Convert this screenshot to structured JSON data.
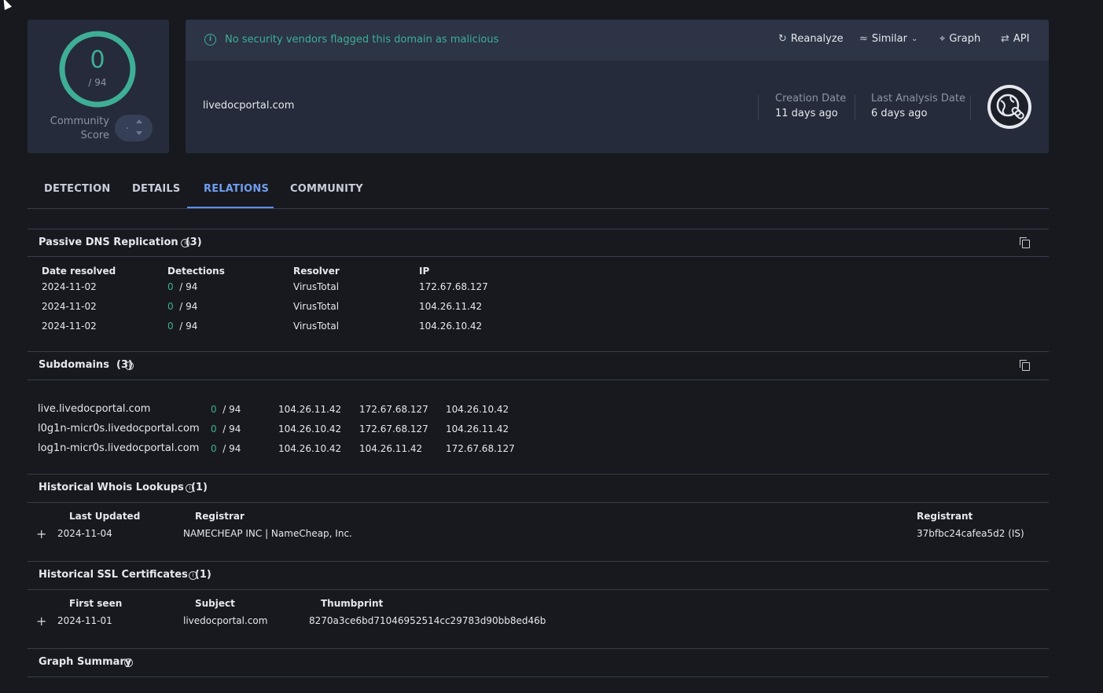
{
  "score": {
    "value": "0",
    "total": "/ 94",
    "community_line1": "Community",
    "community_line2": "Score"
  },
  "banner": {
    "text": "No security vendors flagged this domain as malicious"
  },
  "actions": {
    "reanalyze": "Reanalyze",
    "similar": "Similar",
    "graph": "Graph",
    "api": "API"
  },
  "domain": "livedocportal.com",
  "creation": {
    "label": "Creation Date",
    "value": "11 days ago"
  },
  "last_analysis": {
    "label": "Last Analysis Date",
    "value": "6 days ago"
  },
  "tabs": [
    "DETECTION",
    "DETAILS",
    "RELATIONS",
    "COMMUNITY"
  ],
  "passive_dns": {
    "title": "Passive DNS Replication",
    "count": "(3)",
    "headers": [
      "Date resolved",
      "Detections",
      "Resolver",
      "IP"
    ],
    "rows": [
      {
        "date": "2024-11-02",
        "det": "0",
        "total": "/ 94",
        "resolver": "VirusTotal",
        "ip": "172.67.68.127"
      },
      {
        "date": "2024-11-02",
        "det": "0",
        "total": "/ 94",
        "resolver": "VirusTotal",
        "ip": "104.26.11.42"
      },
      {
        "date": "2024-11-02",
        "det": "0",
        "total": "/ 94",
        "resolver": "VirusTotal",
        "ip": "104.26.10.42"
      }
    ]
  },
  "subdomains": {
    "title": "Subdomains",
    "count": "(3)",
    "rows": [
      {
        "name": "live.livedocportal.com",
        "det": "0",
        "total": "/ 94",
        "ip1": "104.26.11.42",
        "ip2": "172.67.68.127",
        "ip3": "104.26.10.42"
      },
      {
        "name": "l0g1n-micr0s.livedocportal.com",
        "det": "0",
        "total": "/ 94",
        "ip1": "104.26.10.42",
        "ip2": "172.67.68.127",
        "ip3": "104.26.11.42"
      },
      {
        "name": "log1n-micr0s.livedocportal.com",
        "det": "0",
        "total": "/ 94",
        "ip1": "104.26.10.42",
        "ip2": "104.26.11.42",
        "ip3": "172.67.68.127"
      }
    ]
  },
  "whois": {
    "title": "Historical Whois Lookups",
    "count": "(1)",
    "headers": [
      "Last Updated",
      "Registrar",
      "Registrant"
    ],
    "row": {
      "date": "2024-11-04",
      "registrar": "NAMECHEAP INC | NameCheap, Inc.",
      "registrant": "37bfbc24cafea5d2 (IS)"
    }
  },
  "ssl": {
    "title": "Historical SSL Certificates",
    "count": "(1)",
    "headers": [
      "First seen",
      "Subject",
      "Thumbprint"
    ],
    "row": {
      "date": "2024-11-01",
      "subject": "livedocportal.com",
      "thumbprint": "8270a3ce6bd71046952514cc29783d90bb8ed46b"
    }
  },
  "graph_summary": {
    "title": "Graph Summary"
  },
  "colors": {
    "accent_green": "#3fae96",
    "accent_blue": "#5b8de8",
    "card": "#252b3a",
    "background": "#18191e"
  }
}
